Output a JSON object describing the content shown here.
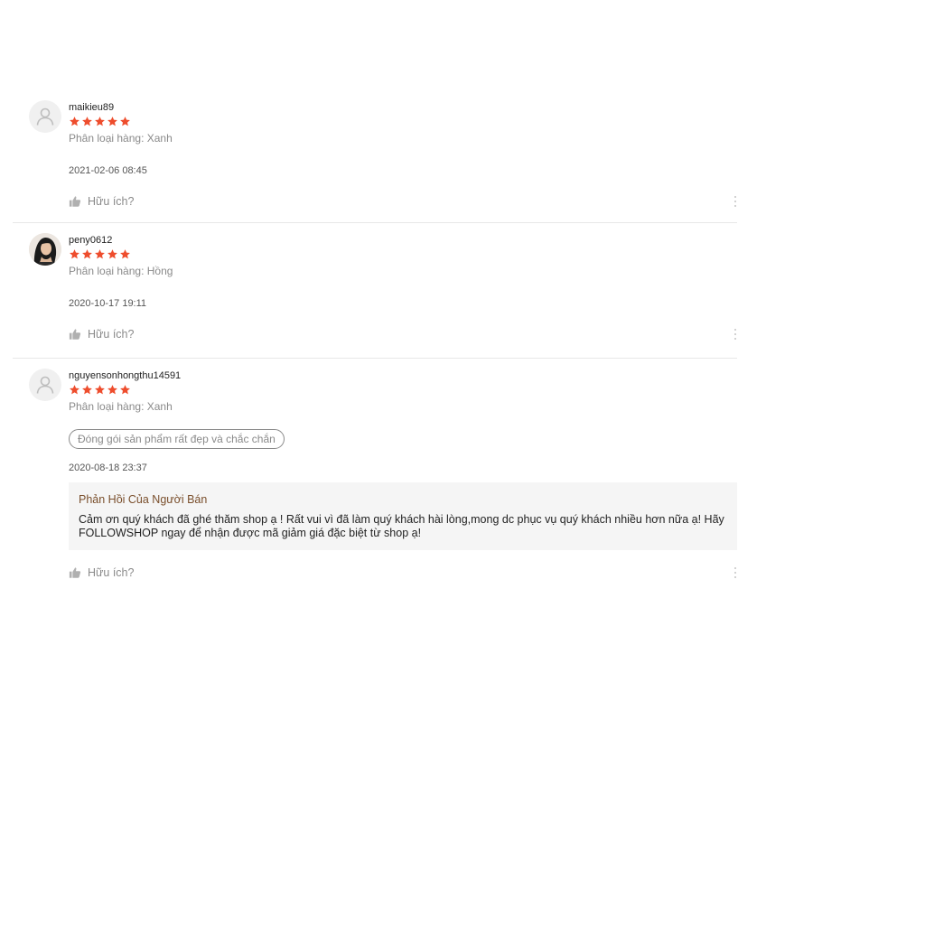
{
  "reviews": [
    {
      "username": "maikieu89",
      "rating": 5,
      "variation": "Phân loại hàng: Xanh",
      "tag": null,
      "timestamp": "2021-02-06 08:45",
      "helpful_label": "Hữu ích?",
      "avatar": "default-user-icon"
    },
    {
      "username": "peny0612",
      "rating": 5,
      "variation": "Phân loại hàng: Hồng",
      "tag": null,
      "timestamp": "2020-10-17 19:11",
      "helpful_label": "Hữu ích?",
      "avatar": "user-photo"
    },
    {
      "username": "nguyensonhongthu14591",
      "rating": 5,
      "variation": "Phân loại hàng: Xanh",
      "tag": "Đóng gói sản phẩm rất đẹp và chắc chắn",
      "timestamp": "2020-08-18 23:37",
      "seller_reply": {
        "title": "Phản Hồi Của Người Bán",
        "text": "Cảm ơn quý khách đã ghé thăm shop ạ ! Rất vui vì đã làm quý khách hài lòng,mong dc phục vụ quý khách nhiều hơn nữa ạ! Hãy\nFOLLOWSHOP ngay để nhận được mã giảm giá đặc biệt từ shop ạ!"
      },
      "helpful_label": "Hữu ích?",
      "avatar": "default-user-icon"
    }
  ],
  "colors": {
    "star": "#ee4d2d",
    "muted": "#8a8a8a",
    "reply_title": "#7a4f2c",
    "reply_bg": "#f5f5f5"
  }
}
